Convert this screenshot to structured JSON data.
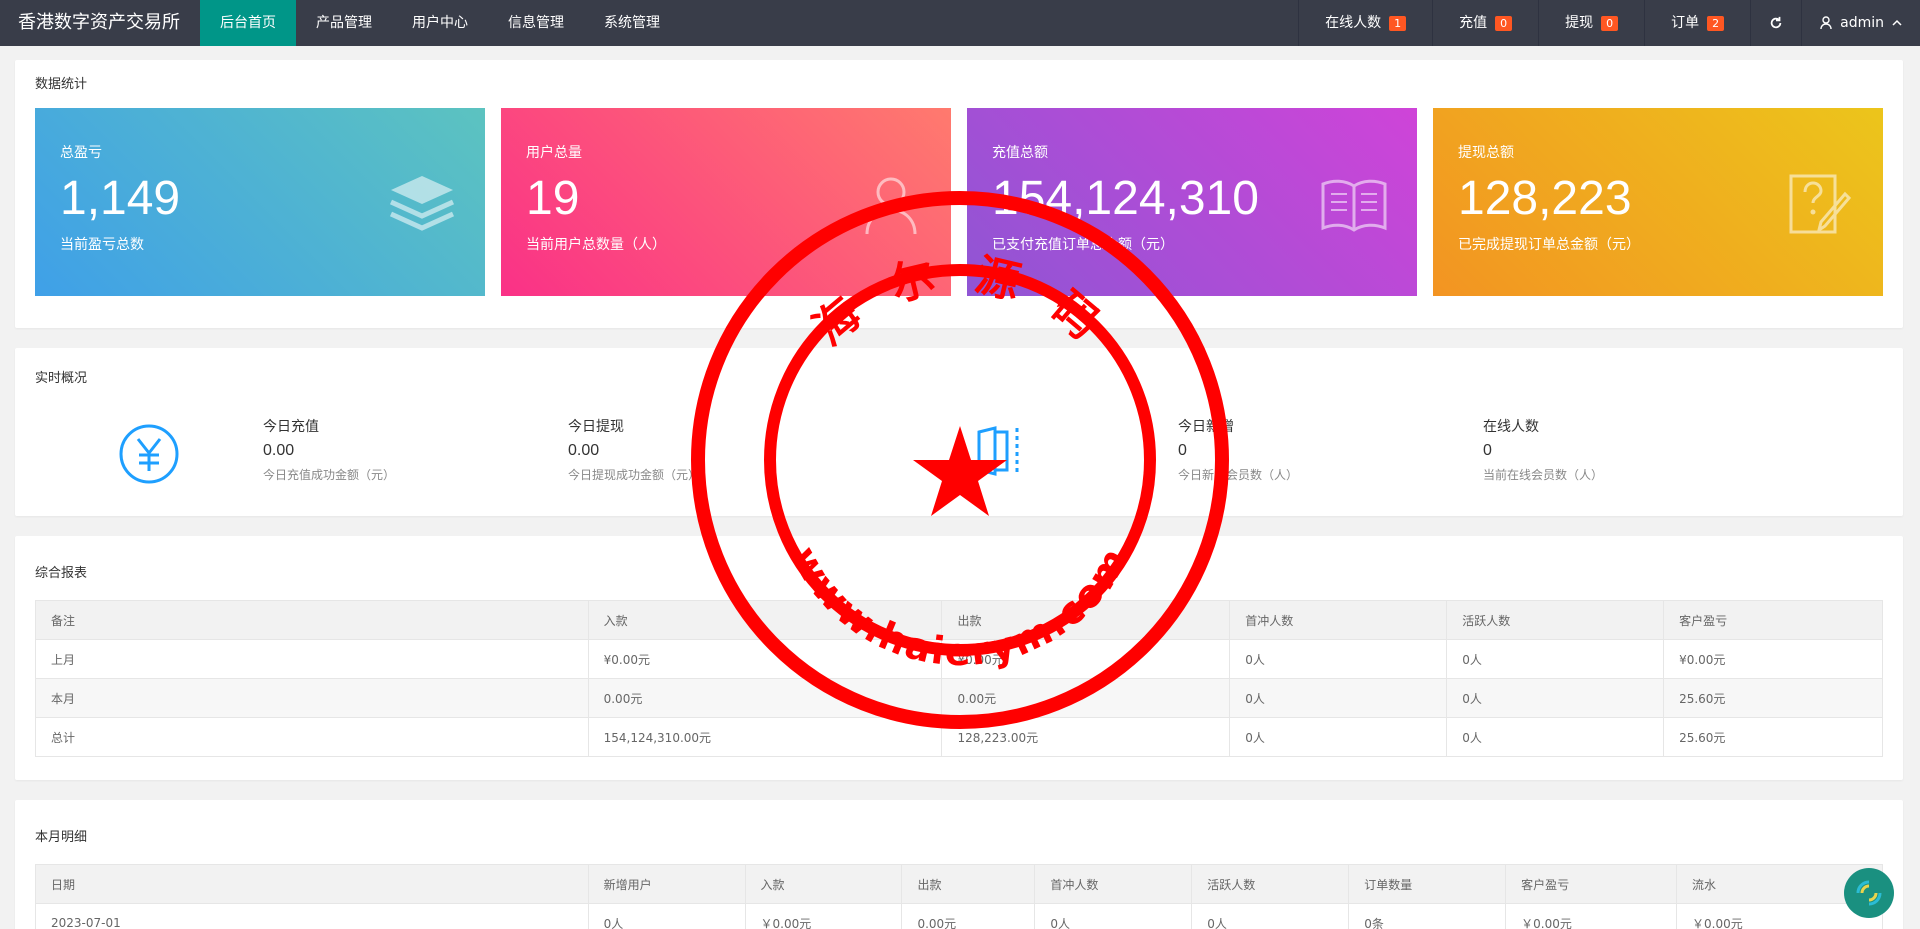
{
  "brand": "香港数字资产交易所",
  "nav": [
    {
      "label": "后台首页",
      "active": true
    },
    {
      "label": "产品管理"
    },
    {
      "label": "用户中心"
    },
    {
      "label": "信息管理"
    },
    {
      "label": "系统管理"
    }
  ],
  "nav_right": {
    "online": {
      "label": "在线人数",
      "count": "1"
    },
    "recharge": {
      "label": "充值",
      "count": "0"
    },
    "withdraw": {
      "label": "提现",
      "count": "0"
    },
    "orders": {
      "label": "订单",
      "count": "2"
    },
    "user": "admin"
  },
  "stats_card": {
    "title": "数据统计",
    "items": [
      {
        "title": "总盈亏",
        "value": "1,149",
        "desc": "当前盈亏总数",
        "icon": "layers-icon"
      },
      {
        "title": "用户总量",
        "value": "19",
        "desc": "当前用户总数量（人）",
        "icon": "users-icon"
      },
      {
        "title": "充值总额",
        "value": "154,124,310",
        "desc": "已支付充值订单总金额（元）",
        "icon": "book-icon"
      },
      {
        "title": "提现总额",
        "value": "128,223",
        "desc": "已完成提现订单总金额（元）",
        "icon": "edit-question-icon"
      }
    ]
  },
  "realtime": {
    "title": "实时概况",
    "items": [
      {
        "label": "今日充值",
        "value": "0.00",
        "desc": "今日充值成功金额（元）"
      },
      {
        "label": "今日提现",
        "value": "0.00",
        "desc": "今日提现成功金额（元）"
      },
      {
        "label": "",
        "value": "",
        "desc": ""
      },
      {
        "label": "今日新增",
        "value": "0",
        "desc": "今日新增会员数（人）"
      },
      {
        "label": "在线人数",
        "value": "0",
        "desc": "当前在线会员数（人）"
      }
    ]
  },
  "report": {
    "title": "综合报表",
    "headers": [
      "备注",
      "入款",
      "出款",
      "首冲人数",
      "活跃人数",
      "客户盈亏"
    ],
    "rows": [
      [
        "上月",
        "¥0.00元",
        "¥0.00元",
        "0人",
        "0人",
        "¥0.00元"
      ],
      [
        "本月",
        "0.00元",
        "0.00元",
        "0人",
        "0人",
        "25.60元"
      ],
      [
        "总计",
        "154,124,310.00元",
        "128,223.00元",
        "0人",
        "0人",
        "25.60元"
      ]
    ]
  },
  "detail": {
    "title": "本月明细",
    "headers": [
      "日期",
      "新增用户",
      "入款",
      "出款",
      "首冲人数",
      "活跃人数",
      "订单数量",
      "客户盈亏",
      "流水"
    ],
    "rows": [
      [
        "2023-07-01",
        "0人",
        "￥0.00元",
        "0.00元",
        "0人",
        "0人",
        "0条",
        "￥0.00元",
        "￥0.00元"
      ]
    ]
  },
  "stamp": {
    "top_text": "海 尔 源 码",
    "bottom_text": "www.haierym.com",
    "color": "#ff0000"
  }
}
